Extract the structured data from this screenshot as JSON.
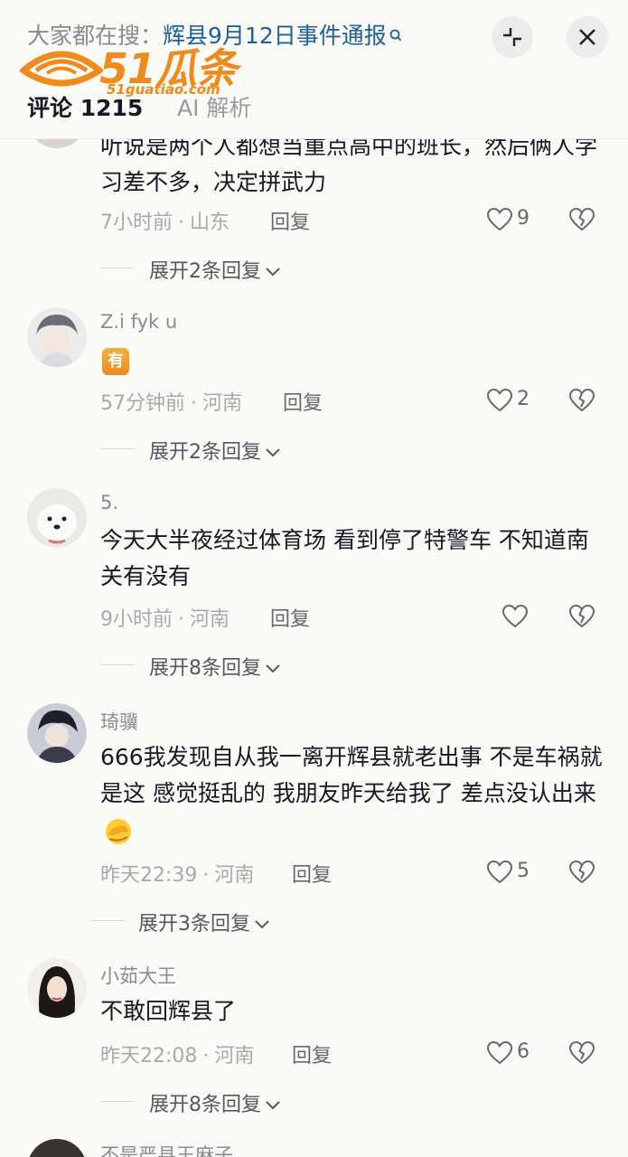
{
  "header": {
    "search_prefix": "大家都在搜：",
    "search_query": "辉县9月12日事件通报",
    "tab_comments": "评论 1215",
    "tab_ai": "AI 解析"
  },
  "watermark": {
    "main": "51瓜条",
    "sub": "51guatiao.com"
  },
  "comments": [
    {
      "text": "听说是两个人都想当重点高中的班长，然后俩人学习差不多，决定拼武力",
      "time_location": [
        "7小时前",
        "山东"
      ],
      "reply": "回复",
      "likes": "9",
      "expand": "展开2条回复"
    },
    {
      "user": "Z.i fyk u",
      "badge": "有",
      "time_location": [
        "57分钟前",
        "河南"
      ],
      "reply": "回复",
      "likes": "2",
      "expand": "展开2条回复"
    },
    {
      "user": "5.",
      "text": "今天大半夜经过体育场 看到停了特警车 不知道南关有没有",
      "time_location": [
        "9小时前",
        "河南"
      ],
      "reply": "回复",
      "likes": "",
      "expand": "展开8条回复"
    },
    {
      "user": "琦骥",
      "text": "666我发现自从我一离开辉县就老出事 不是车祸就是这 感觉挺乱的 我朋友昨天给我了 差点没认出来",
      "time_location": [
        "昨天22:39",
        "河南"
      ],
      "reply": "回复",
      "likes": "5",
      "expand": "展开3条回复"
    },
    {
      "user": "小茹大王",
      "text": "不敢回辉县了",
      "time_location": [
        "昨天22:08",
        "河南"
      ],
      "reply": "回复",
      "likes": "6",
      "expand": "展开8条回复"
    },
    {
      "user": "不是严县王麻子"
    }
  ],
  "colors": {
    "accent_link": "#1f5f9a",
    "watermark": "#f08a1a",
    "badge": "#ee8a1c"
  }
}
